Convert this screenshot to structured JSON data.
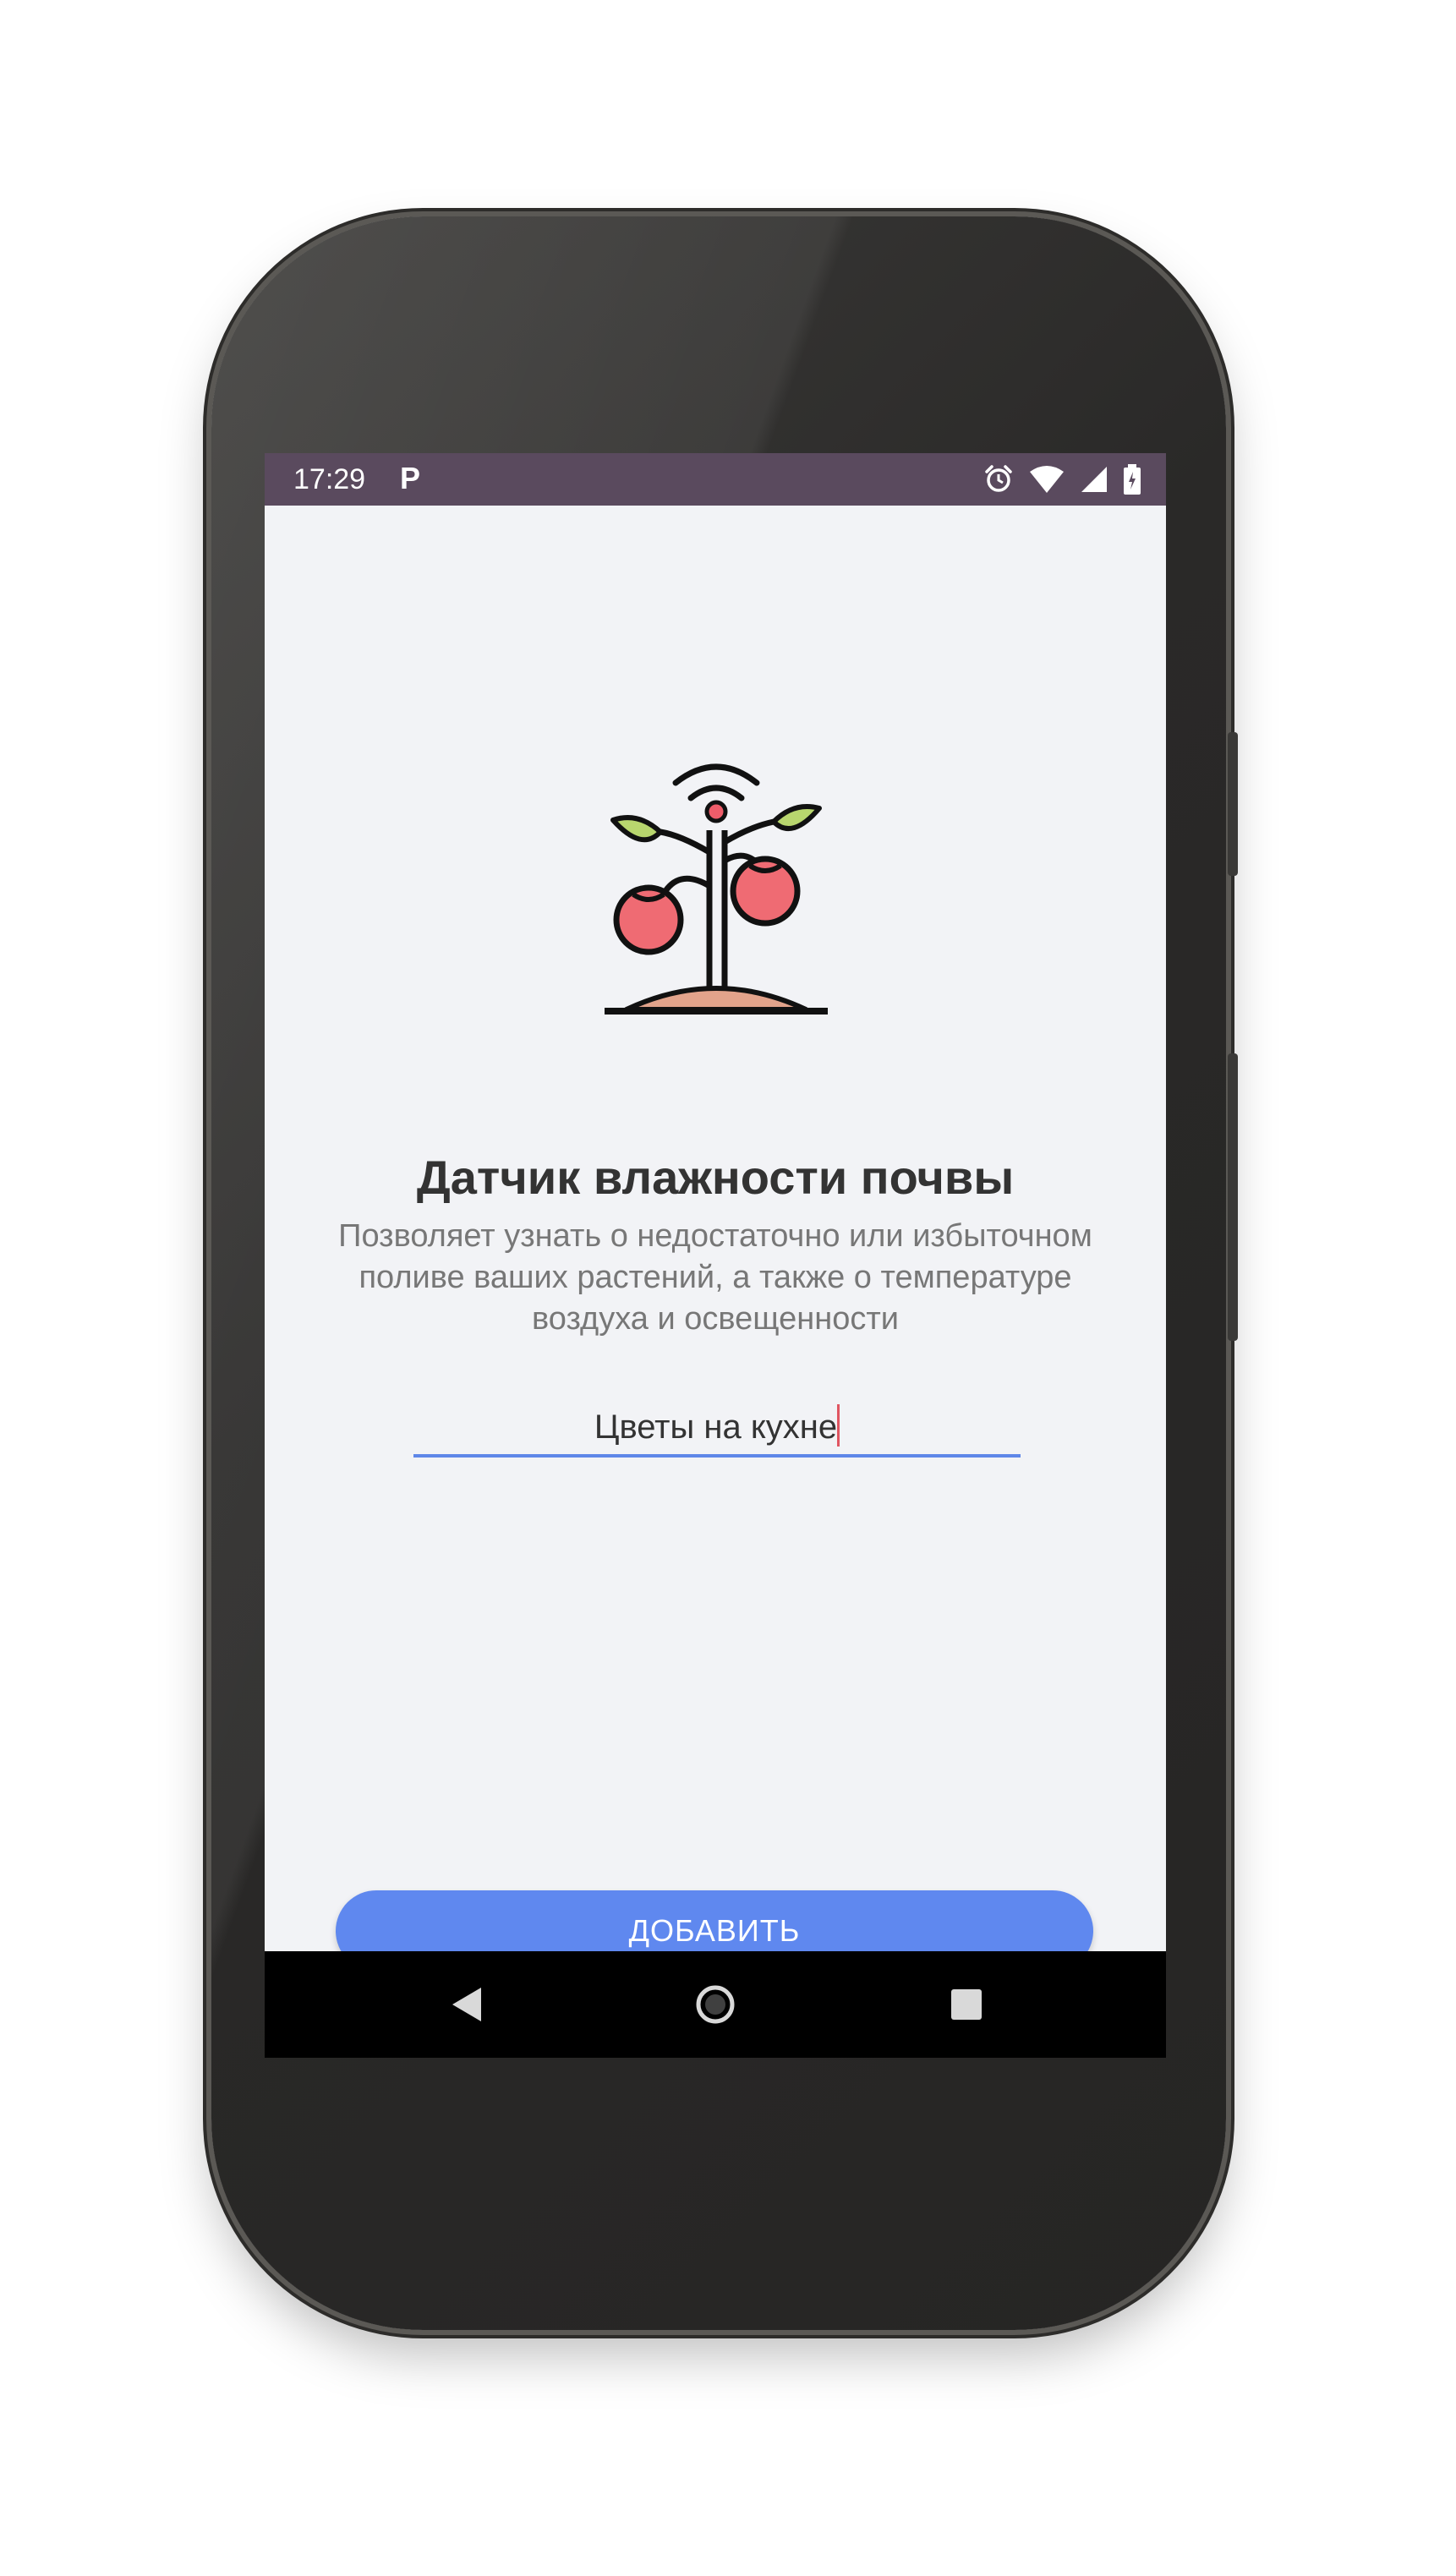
{
  "status_bar": {
    "time": "17:29",
    "notification_icon": "P",
    "icons": [
      "alarm-icon",
      "wifi-icon",
      "signal-icon",
      "battery-icon"
    ],
    "background": "#5a4a5e"
  },
  "onboarding": {
    "illustration": "smart-plant-icon",
    "title": "Датчик влажности почвы",
    "description": "Позволяет узнать о недостаточно или избыточном поливе ваших растений, а также о температуре воздуха и освещенности",
    "name_input": {
      "value": "Цветы на кухне"
    },
    "add_button_label": "ДОБАВИТЬ"
  },
  "navigation": {
    "buttons": [
      "back-icon",
      "home-icon",
      "recents-icon"
    ]
  },
  "colors": {
    "accent": "#5f88ef",
    "screen_background": "#f2f3f6",
    "caret": "#e05561"
  }
}
